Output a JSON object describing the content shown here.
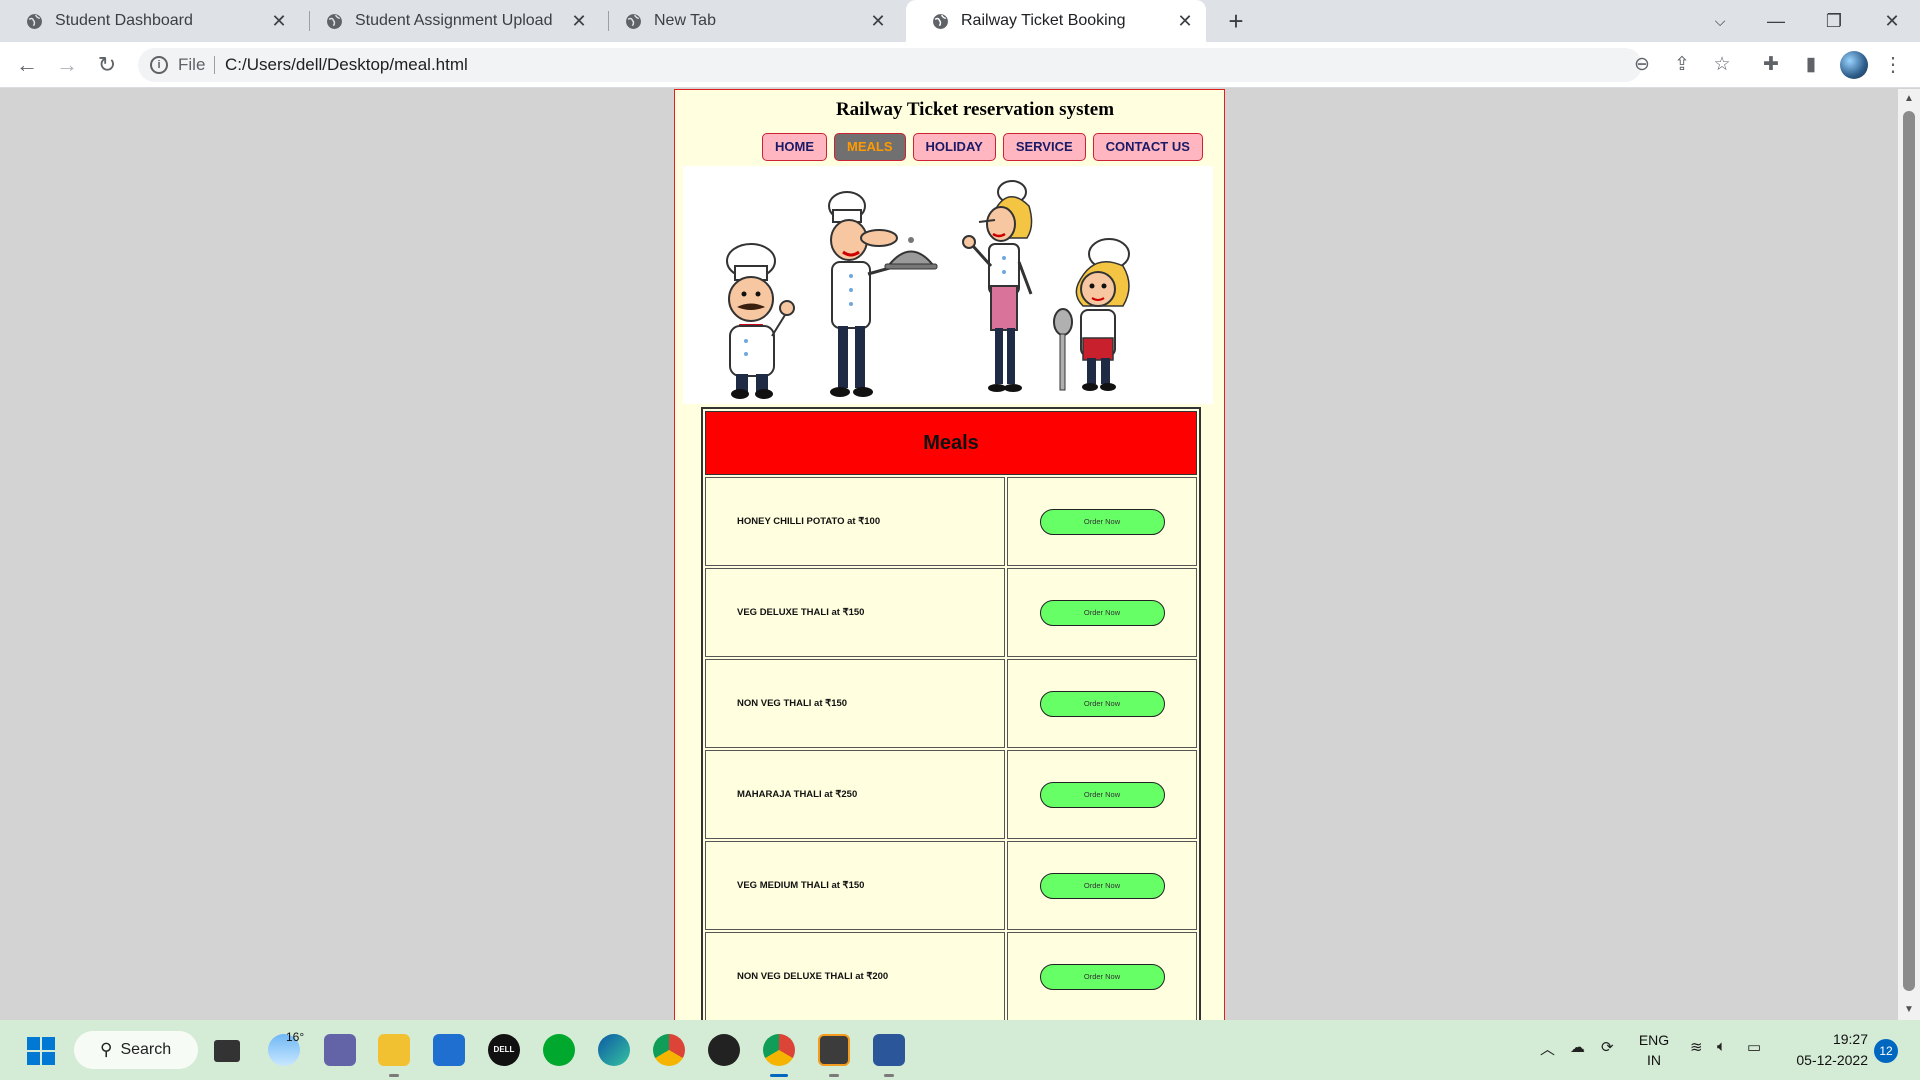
{
  "browser": {
    "tabs": [
      {
        "title": "Student Dashboard"
      },
      {
        "title": "Student Assignment Upload"
      },
      {
        "title": "New Tab"
      },
      {
        "title": "Railway Ticket Booking"
      }
    ],
    "address": {
      "scheme_label": "File",
      "url": "C:/Users/dell/Desktop/meal.html"
    }
  },
  "site": {
    "title": "Railway Ticket reservation system",
    "menu": [
      {
        "label": "HOME"
      },
      {
        "label": "MEALS",
        "active": true
      },
      {
        "label": "HOLIDAY"
      },
      {
        "label": "SERVICE"
      },
      {
        "label": "CONTACT US"
      }
    ]
  },
  "meals": {
    "heading": "Meals",
    "items": [
      {
        "name": "HONEY CHILLI POTATO at ₹100",
        "button": "Order Now"
      },
      {
        "name": "VEG DELUXE THALI at ₹150",
        "button": "Order Now"
      },
      {
        "name": "NON VEG THALI at ₹150",
        "button": "Order Now"
      },
      {
        "name": "MAHARAJA THALI at ₹250",
        "button": "Order Now"
      },
      {
        "name": "VEG MEDIUM THALI at ₹150",
        "button": "Order Now"
      },
      {
        "name": "NON VEG DELUXE THALI at ₹200",
        "button": "Order Now"
      }
    ]
  },
  "taskbar": {
    "search_label": "Search",
    "weather_temp": "16°",
    "lang_line1": "ENG",
    "lang_line2": "IN",
    "time": "19:27",
    "date": "05-12-2022",
    "notification_count": "12",
    "dell_logo_text": "DELL"
  },
  "colors": {
    "page_bg": "#d3d3d3",
    "container_bg": "#ffffe0",
    "container_border": "#e02020",
    "menu_bg": "#ffb6c1",
    "menu_active_bg": "#707070",
    "menu_active_text": "#ff9a00",
    "meals_header_bg": "#ff0000",
    "order_button_bg": "#66ff66",
    "taskbar_bg": "#d4ecd6"
  }
}
